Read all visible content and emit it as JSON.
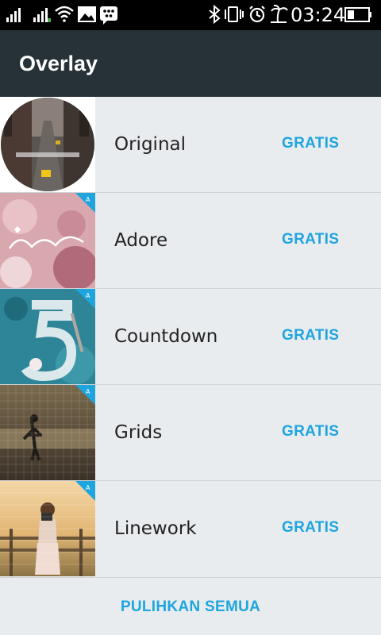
{
  "status_bar": {
    "time": "03:24",
    "icons": [
      "signal-icon",
      "signal-icon",
      "wifi-icon",
      "image-notification-icon",
      "bbm-icon",
      "bluetooth-icon",
      "vibrate-icon",
      "alarm-icon",
      "tree-icon",
      "battery-icon"
    ]
  },
  "app_bar": {
    "title": "Overlay"
  },
  "items": [
    {
      "label": "Original",
      "price": "GRATIS"
    },
    {
      "label": "Adore",
      "price": "GRATIS"
    },
    {
      "label": "Countdown",
      "price": "GRATIS"
    },
    {
      "label": "Grids",
      "price": "GRATIS"
    },
    {
      "label": "Linework",
      "price": "GRATIS"
    }
  ],
  "footer": {
    "restore_label": "PULIHKAN SEMUA"
  },
  "colors": {
    "accent": "#1ea5de",
    "app_bar": "#263238",
    "background": "#e9ecef"
  }
}
